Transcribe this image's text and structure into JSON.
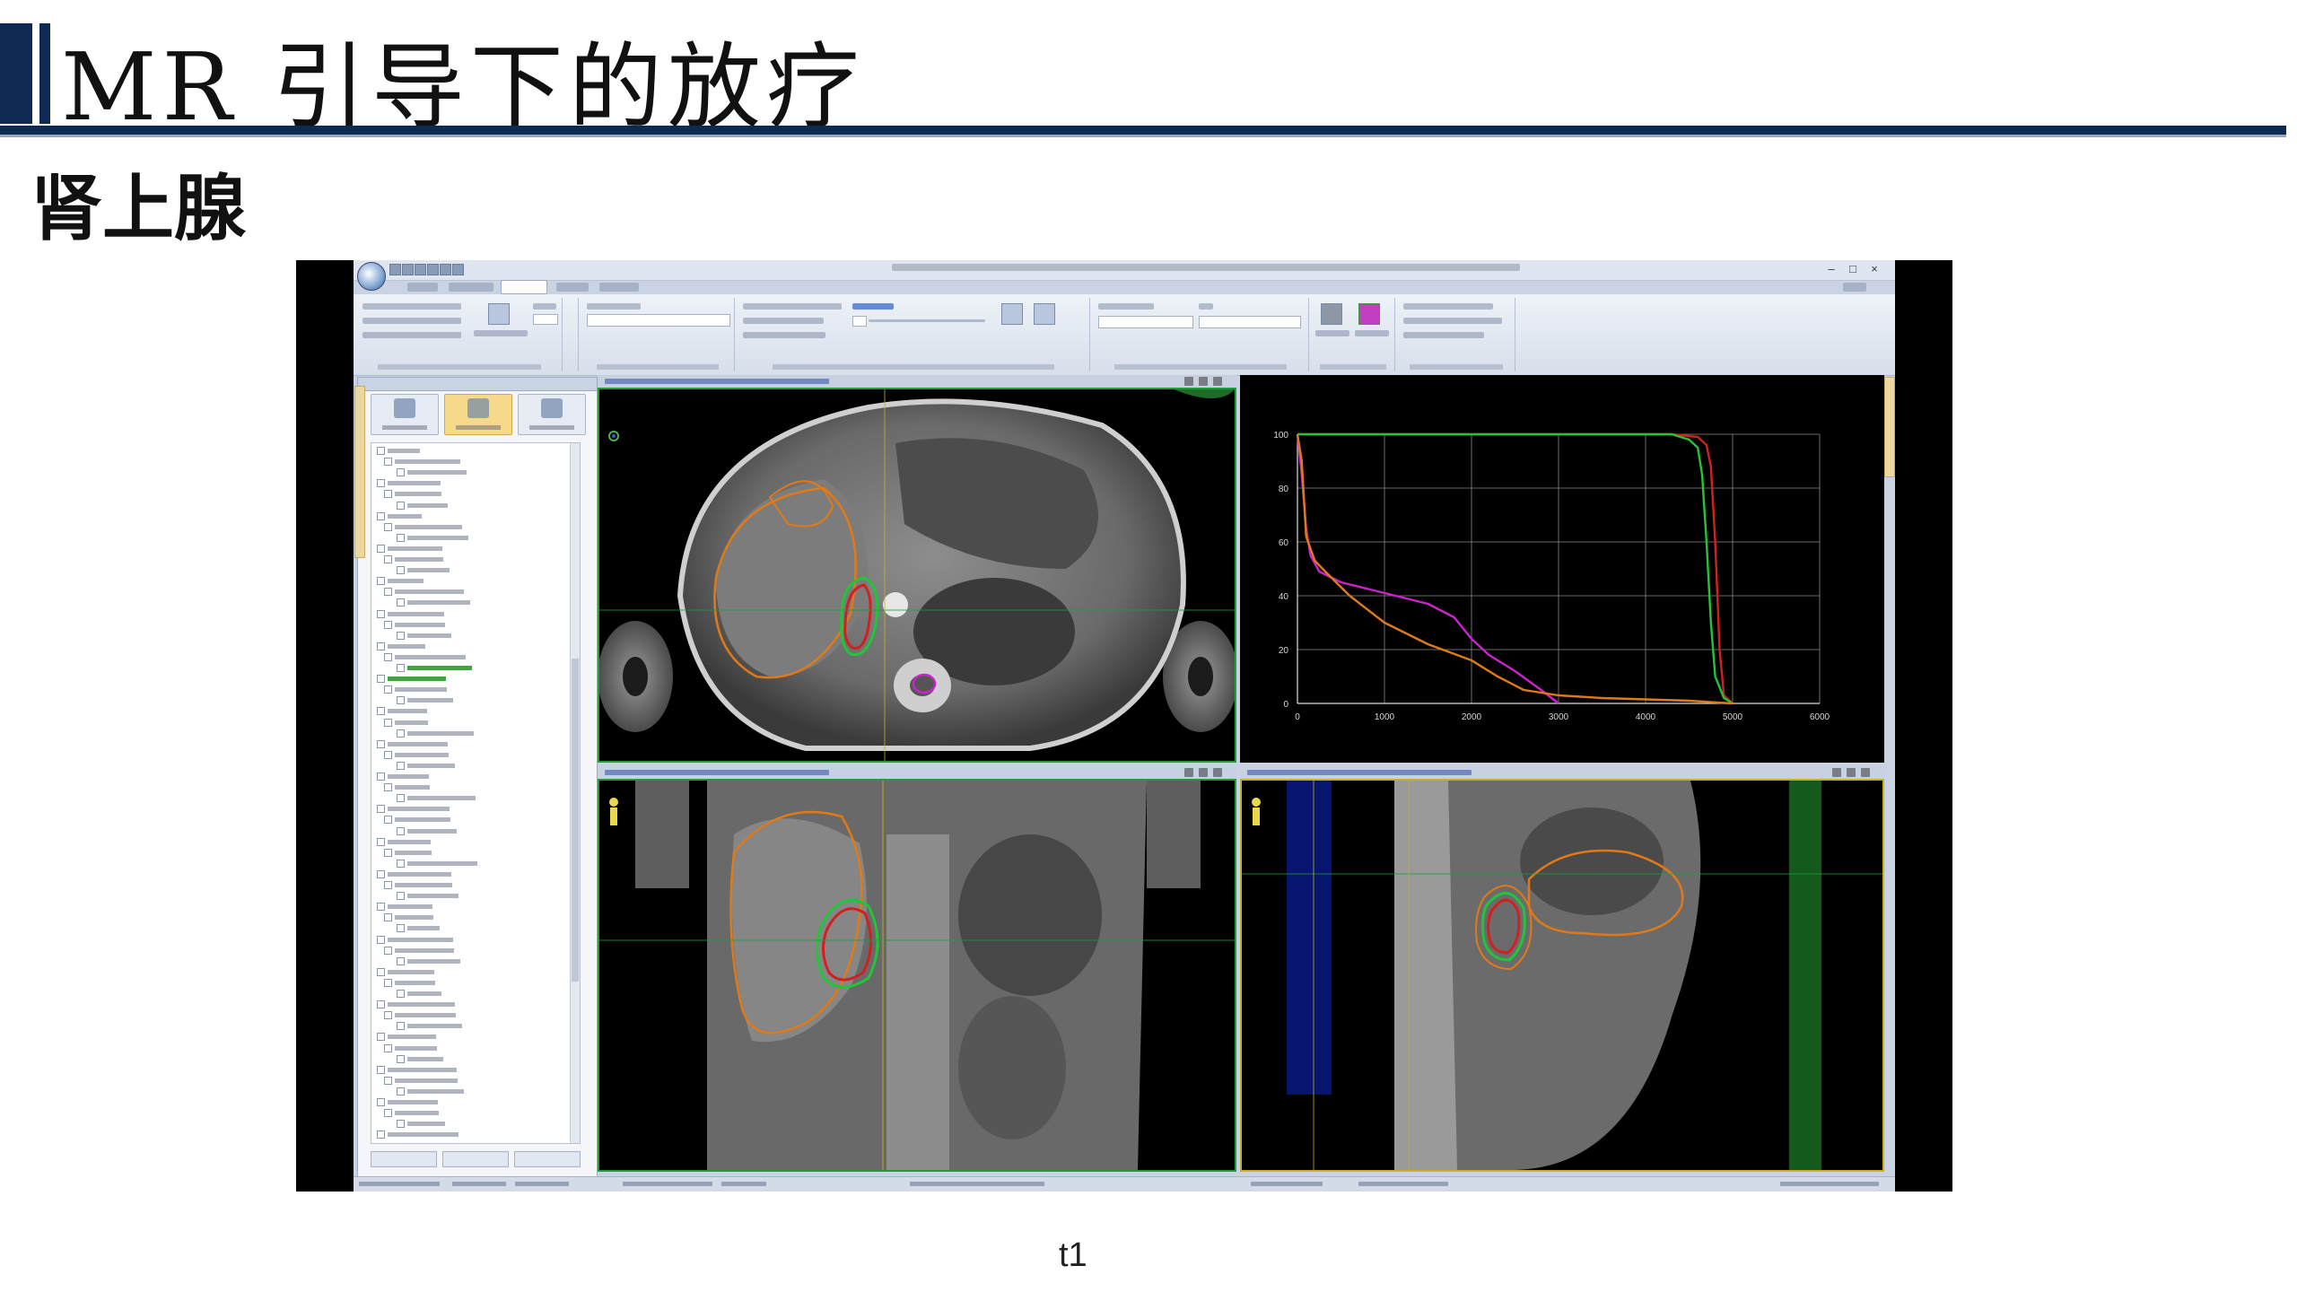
{
  "slide": {
    "title": "MR 引导下的放疗",
    "subtitle": "肾上腺",
    "caption": "t1"
  },
  "dvh_chart": {
    "type": "line",
    "y_ticks": [
      "0",
      "20",
      "40",
      "60",
      "80",
      "100"
    ],
    "x_ticks": [
      "0",
      "1000",
      "2000",
      "3000",
      "4000",
      "5000",
      "6000"
    ],
    "title": "",
    "subtitle": "",
    "xlabel": "",
    "ylabel": ""
  },
  "chart_data": {
    "type": "line",
    "title": "",
    "xlabel": "",
    "ylabel": "",
    "xlim": [
      0,
      6000
    ],
    "ylim": [
      0,
      100
    ],
    "grid": true,
    "series": [
      {
        "color": "#d12020",
        "x": [
          0,
          4300,
          4600,
          4700,
          4750,
          4800,
          4850,
          4900,
          5000
        ],
        "y": [
          100,
          100,
          99,
          96,
          88,
          60,
          20,
          3,
          0
        ]
      },
      {
        "color": "#22c43a",
        "x": [
          0,
          4300,
          4500,
          4600,
          4650,
          4700,
          4750,
          4800,
          4900,
          5000
        ],
        "y": [
          100,
          100,
          98,
          95,
          85,
          60,
          30,
          10,
          2,
          0
        ]
      },
      {
        "color": "#cc22cc",
        "x": [
          0,
          50,
          100,
          150,
          250,
          500,
          1000,
          1500,
          1800,
          2000,
          2200,
          2500,
          2800,
          3000
        ],
        "y": [
          100,
          85,
          65,
          55,
          49,
          45,
          41,
          37,
          32,
          24,
          18,
          12,
          5,
          0
        ]
      },
      {
        "color": "#e07a18",
        "x": [
          0,
          50,
          100,
          200,
          350,
          600,
          1000,
          1500,
          2000,
          2300,
          2600,
          3000,
          3500,
          4000,
          4500,
          5000
        ],
        "y": [
          100,
          90,
          62,
          53,
          48,
          40,
          30,
          22,
          16,
          10,
          5,
          3,
          2,
          1.5,
          1,
          0
        ]
      }
    ]
  },
  "colors": {
    "title_bar": "#0f2a52",
    "viewport_border_active": "#1e9d3a",
    "viewport_border_selected": "#c8b21c",
    "contour_orange": "#e07a18",
    "contour_red": "#d12020",
    "contour_green": "#22c43a",
    "contour_magenta": "#cc22cc"
  }
}
